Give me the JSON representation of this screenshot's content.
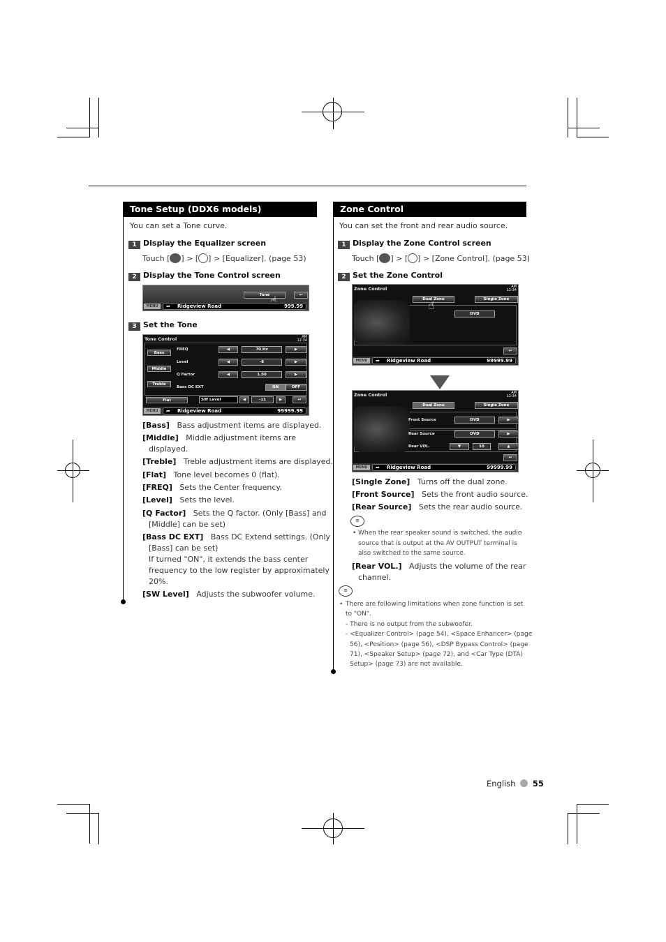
{
  "left": {
    "title": "Tone Setup (DDX6 models)",
    "intro": "You can set a Tone curve.",
    "steps": [
      {
        "num": "1",
        "title": "Display the Equalizer screen",
        "text_pre": "Touch [",
        "text_mid": "] > [",
        "text_post": "] > [Equalizer]. (page 53)"
      },
      {
        "num": "2",
        "title": "Display the Tone Control screen"
      },
      {
        "num": "3",
        "title": "Set the Tone"
      }
    ],
    "screen_step2": {
      "button": "Tone",
      "menu": "MENU",
      "road": "Ridgeview Road",
      "distance": "999.99"
    },
    "tone_screen": {
      "title": "Tone Control",
      "clock_ampm": "AM",
      "clock_time": "12:34",
      "tabs": [
        "Bass",
        "Middle",
        "Treble"
      ],
      "rows": [
        {
          "label": "FREQ",
          "value": "70 Hz"
        },
        {
          "label": "Level",
          "value": "-8"
        },
        {
          "label": "Q Factor",
          "value": "1.50"
        }
      ],
      "bass_dc_label": "Bass DC EXT",
      "on": "ON",
      "off": "OFF",
      "flat": "Flat",
      "sw_label": "SW Level",
      "sw_value": "-11",
      "menu": "MENU",
      "road": "Ridgeview Road",
      "distance": "99999.99"
    },
    "items": [
      {
        "key": "[Bass]",
        "desc": "Bass adjustment items are displayed."
      },
      {
        "key": "[Middle]",
        "desc": "Middle adjustment items are",
        "cont": [
          "displayed."
        ]
      },
      {
        "key": "[Treble]",
        "desc": "Treble adjustment items are displayed."
      },
      {
        "key": "[Flat]",
        "desc": "Tone level becomes 0 (flat)."
      },
      {
        "key": "[FREQ]",
        "desc": "Sets the Center frequency."
      },
      {
        "key": "[Level]",
        "desc": "Sets the level."
      },
      {
        "key": "[Q Factor]",
        "desc": "Sets the Q factor.  (Only [Bass] and",
        "cont": [
          "[Middle] can be set)"
        ]
      },
      {
        "key": "[Bass DC EXT]",
        "desc": "Bass DC Extend settings. (Only",
        "cont": [
          "[Bass] can be set)",
          "If turned \"ON\", it extends the bass center",
          "frequency to the low register by approximately",
          "20%."
        ]
      },
      {
        "key": "[SW Level]",
        "desc": "Adjusts the subwoofer volume."
      }
    ]
  },
  "right": {
    "title": "Zone Control",
    "intro": "You can set the front and rear audio source.",
    "steps": [
      {
        "num": "1",
        "title": "Display the Zone Control screen",
        "text_pre": "Touch [",
        "text_mid": "] > [",
        "text_post": "] > [Zone Control]. (page 53)"
      },
      {
        "num": "2",
        "title": "Set the Zone Control"
      }
    ],
    "zone_screen_1": {
      "title": "Zone Control",
      "clock_ampm": "AM",
      "clock_time": "12:34",
      "dual": "Dual Zone",
      "single": "Single Zone",
      "source": "DVD",
      "menu": "MENU",
      "road": "Ridgeview Road",
      "distance": "99999.99"
    },
    "zone_screen_2": {
      "title": "Zone Control",
      "clock_ampm": "AM",
      "clock_time": "12:34",
      "dual": "Dual Zone",
      "single": "Single Zone",
      "front_label": "Front Source",
      "front_value": "DVD",
      "rear_label": "Rear Source",
      "rear_value": "DVD",
      "vol_label": "Rear VOL.",
      "vol_value": "10",
      "menu": "MENU",
      "road": "Ridgeview Road",
      "distance": "99999.99"
    },
    "items": [
      {
        "key": "[Single Zone]",
        "desc": "Turns off the dual zone."
      },
      {
        "key": "[Front Source]",
        "desc": "Sets the front audio source."
      },
      {
        "key": "[Rear Source]",
        "desc": "Sets the rear audio source."
      }
    ],
    "note1": [
      "When the rear speaker sound is switched, the audio",
      "source that is output at the AV OUTPUT terminal is",
      "also switched to the same source."
    ],
    "rear_vol": {
      "key": "[Rear VOL.]",
      "desc": "Adjusts the volume of the rear",
      "cont": "channel."
    },
    "note2": [
      "There are following limitations when zone function is set",
      "to \"ON\".",
      "- There is no output from the subwoofer.",
      "- <Equalizer Control> (page 54), <Space Enhancer> (page",
      "56), <Position> (page 56), <DSP Bypass Control> (page",
      "71), <Speaker Setup> (page 72), and <Car Type (DTA)",
      "Setup> (page 73) are not available."
    ]
  },
  "footer": {
    "language": "English",
    "page": "55"
  }
}
